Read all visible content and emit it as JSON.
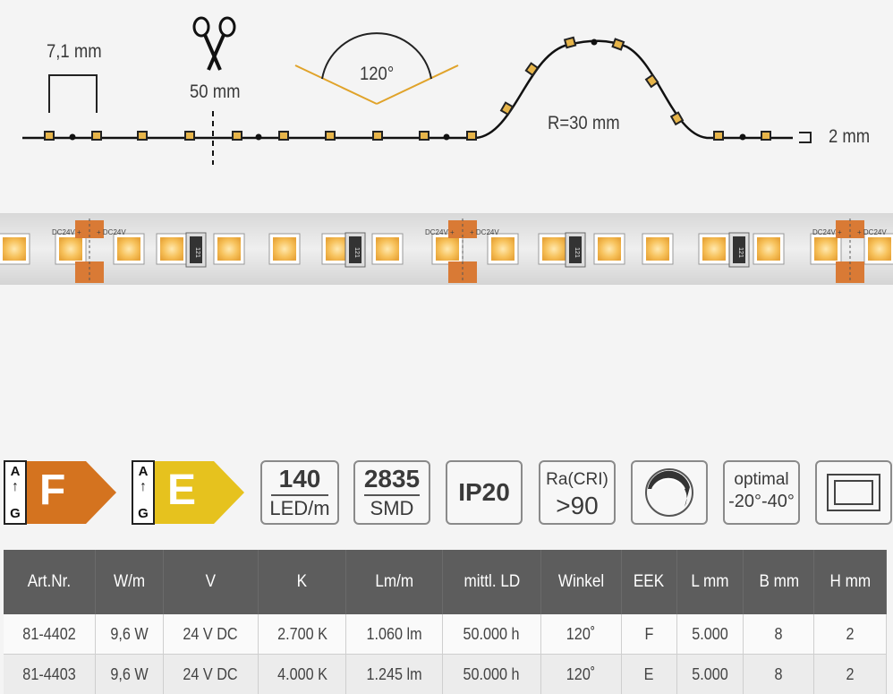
{
  "diagram": {
    "pitch_label": "7,1 mm",
    "cut_label": "50 mm",
    "angle_label": "120°",
    "radius_label": "R=30 mm",
    "height_label": "2 mm"
  },
  "strip": {
    "voltage_label": "DC24V",
    "resistor_label": "121",
    "plus": "+",
    "minus": "−"
  },
  "badges": {
    "energy_scale_top": "A",
    "energy_scale_bottom": "G",
    "energy_class_1": "F",
    "energy_class_2": "E",
    "energy_color_1": "#d4731f",
    "energy_color_2": "#e6c21e",
    "led_count": "140",
    "led_unit": "LED/m",
    "smd_type": "2835",
    "smd_label": "SMD",
    "ip_rating": "IP20",
    "cri_label": "Ra(CRI)",
    "cri_value": ">90",
    "temp_label": "optimal",
    "temp_range": "-20°-40°"
  },
  "table": {
    "headers": [
      "Art.Nr.",
      "W/m",
      "V",
      "K",
      "Lm/m",
      "mittl. LD",
      "Winkel",
      "EEK",
      "L mm",
      "B mm",
      "H mm"
    ],
    "rows": [
      [
        "81-4402",
        "9,6 W",
        "24 V DC",
        "2.700 K",
        "1.060 lm",
        "50.000 h",
        "120˚",
        "F",
        "5.000",
        "8",
        "2"
      ],
      [
        "81-4403",
        "9,6 W",
        "24 V DC",
        "4.000 K",
        "1.245 lm",
        "50.000 h",
        "120˚",
        "E",
        "5.000",
        "8",
        "2"
      ]
    ]
  }
}
